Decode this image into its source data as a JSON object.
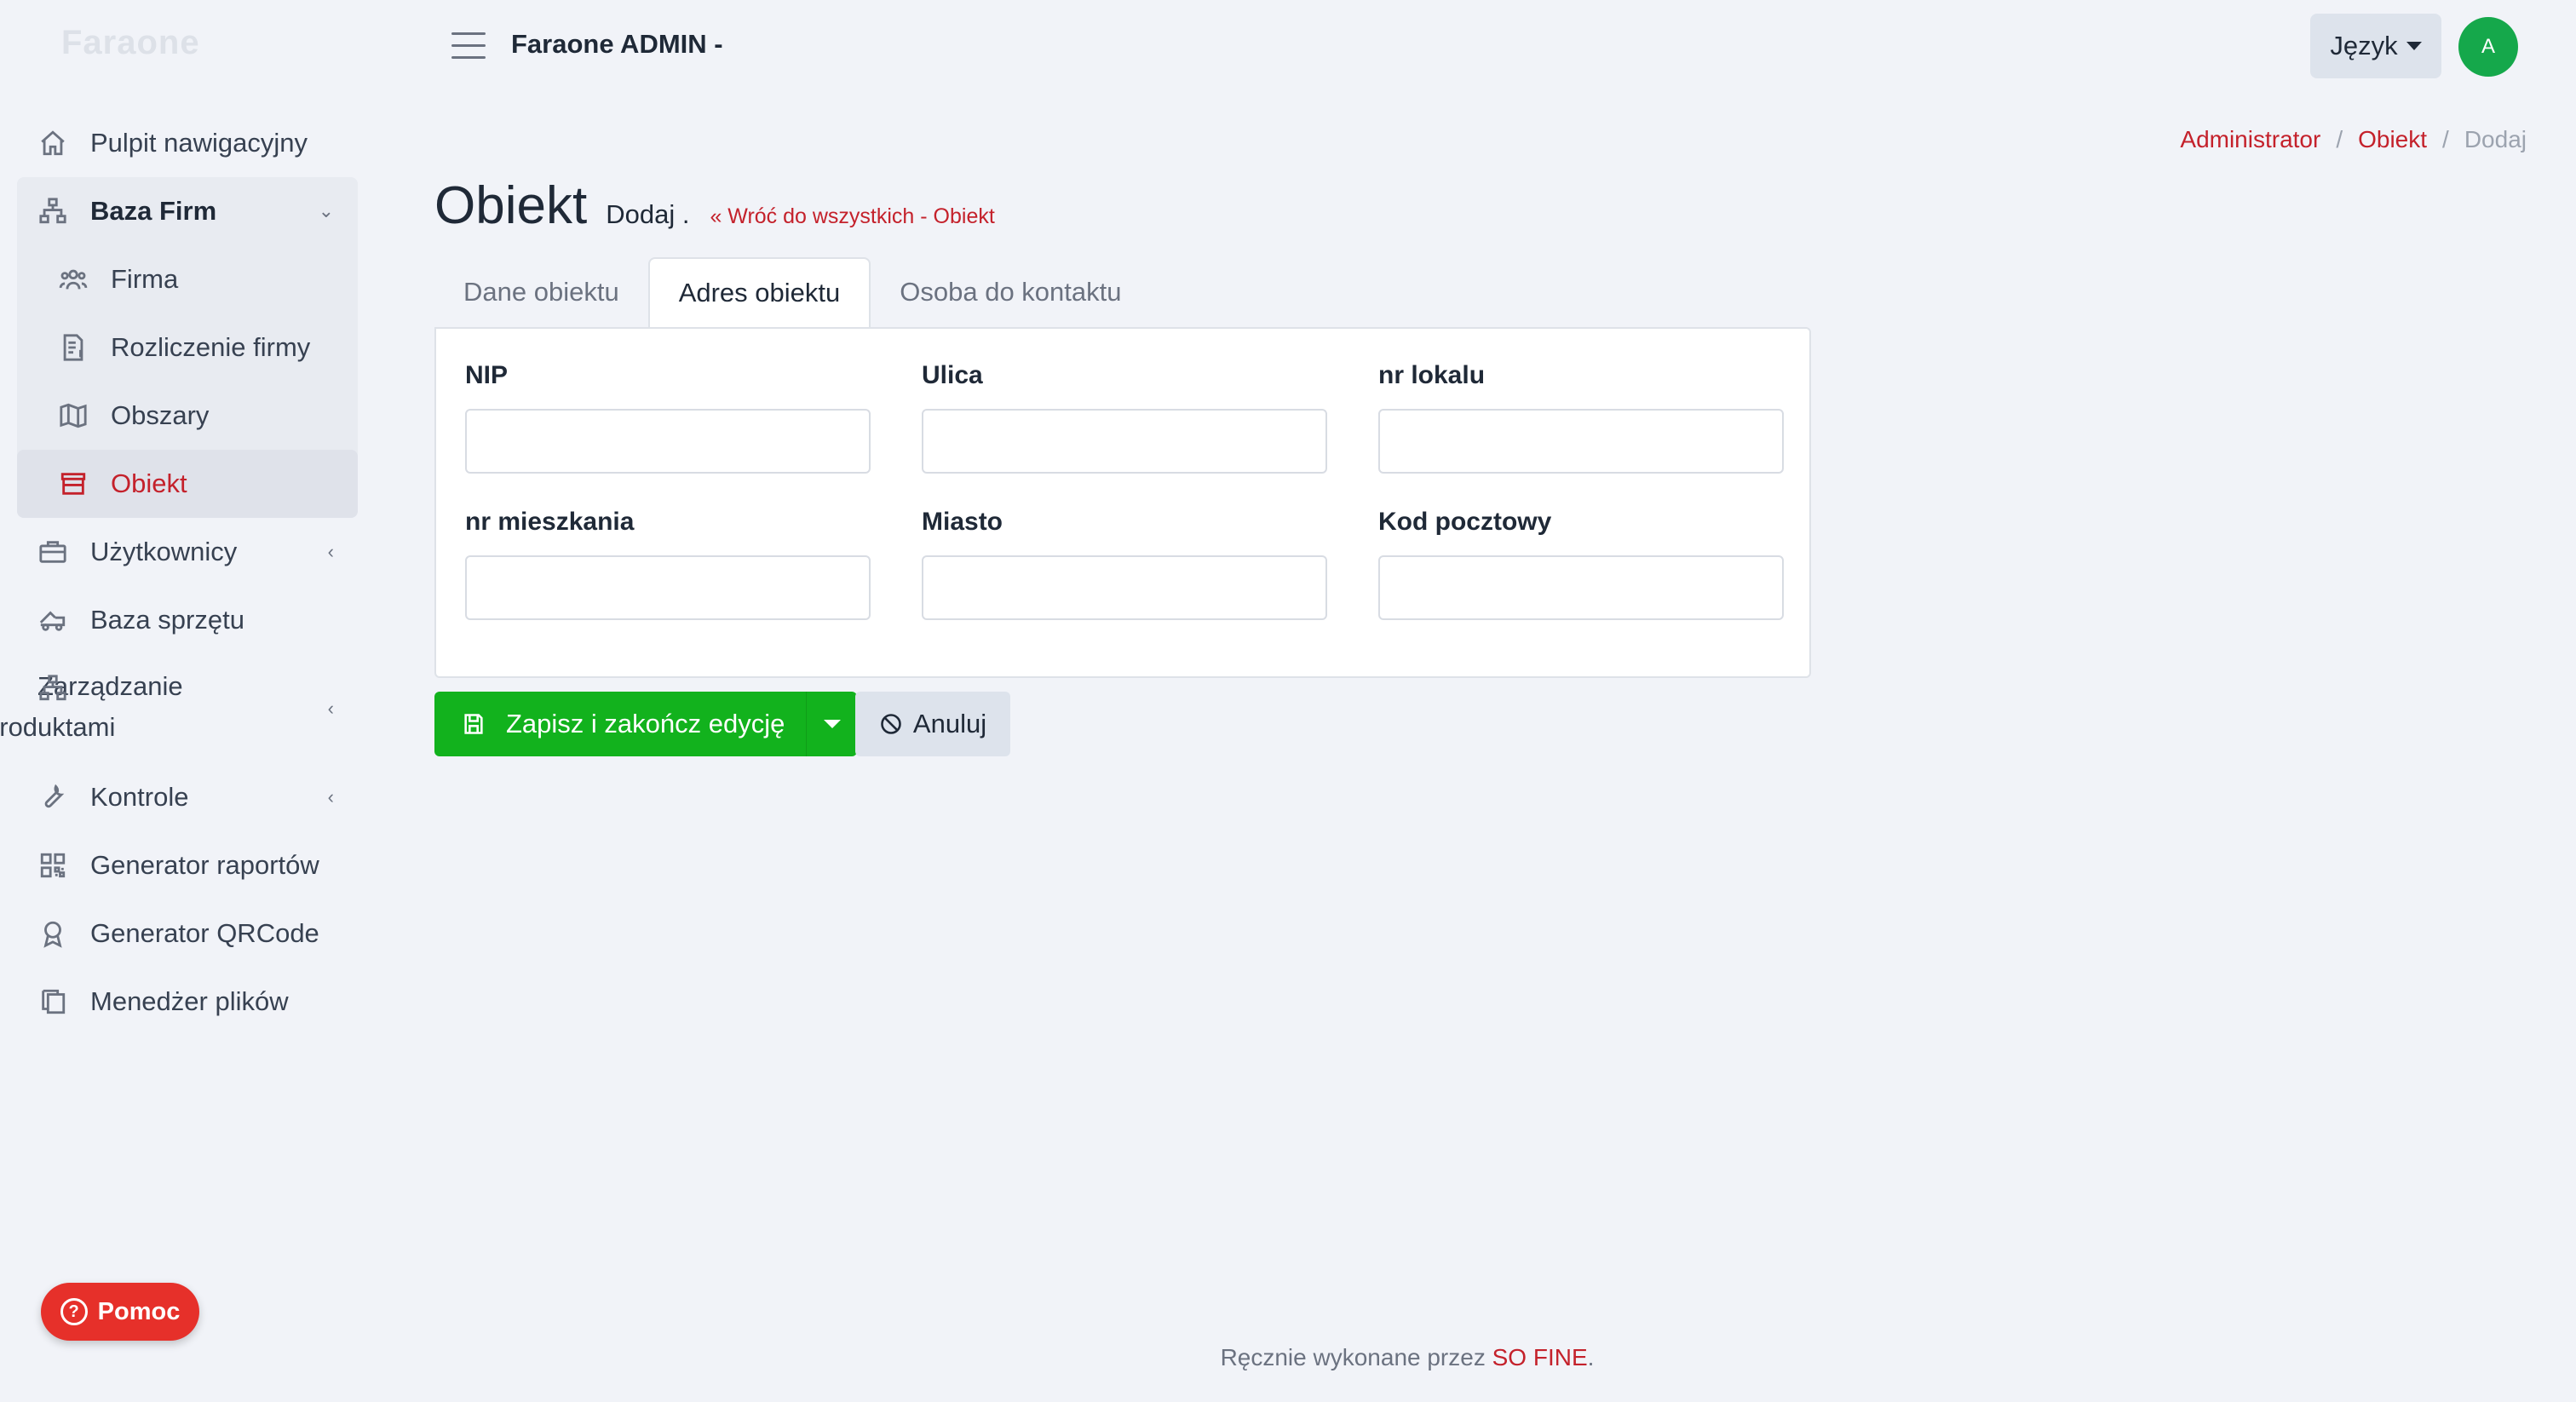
{
  "app": {
    "brand": "Faraone",
    "top_title": "Faraone ADMIN -",
    "language_label": "Język",
    "avatar_initial": "A",
    "help_label": "Pomoc"
  },
  "sidebar": {
    "items": [
      {
        "label": "Pulpit nawigacyjny",
        "icon": "home-icon"
      },
      {
        "label": "Baza Firm",
        "icon": "sitemap-icon",
        "expanded": true,
        "children": [
          {
            "label": "Firma",
            "icon": "users-icon"
          },
          {
            "label": "Rozliczenie firmy",
            "icon": "invoice-icon"
          },
          {
            "label": "Obszary",
            "icon": "map-icon"
          },
          {
            "label": "Obiekt",
            "icon": "store-icon",
            "active": true
          }
        ]
      },
      {
        "label": "Użytkownicy",
        "icon": "briefcase-icon"
      },
      {
        "label": "Baza sprzętu",
        "icon": "truck-icon"
      },
      {
        "label": "Zarządzanie produktami",
        "icon": "sitemap-icon"
      },
      {
        "label": "Kontrole",
        "icon": "wrench-icon"
      },
      {
        "label": "Generator raportów",
        "icon": "qrcode-icon"
      },
      {
        "label": "Generator QRCode",
        "icon": "award-icon"
      },
      {
        "label": "Menedżer plików",
        "icon": "copy-icon"
      }
    ]
  },
  "breadcrumb": {
    "items": [
      "Administrator",
      "Obiekt"
    ],
    "current": "Dodaj",
    "separator": "/"
  },
  "page": {
    "title": "Obiekt",
    "subtitle": "Dodaj .",
    "back_link": "Wróć do wszystkich - Obiekt"
  },
  "tabs": [
    {
      "label": "Dane obiektu",
      "active": false
    },
    {
      "label": "Adres obiektu",
      "active": true
    },
    {
      "label": "Osoba do kontaktu",
      "active": false
    }
  ],
  "form": {
    "fields": [
      {
        "label": "NIP",
        "value": ""
      },
      {
        "label": "Ulica",
        "value": ""
      },
      {
        "label": "nr lokalu",
        "value": ""
      },
      {
        "label": "nr mieszkania",
        "value": ""
      },
      {
        "label": "Miasto",
        "value": ""
      },
      {
        "label": "Kod pocztowy",
        "value": ""
      }
    ]
  },
  "actions": {
    "save_label": "Zapisz i zakończ edycję",
    "cancel_label": "Anuluj"
  },
  "footer": {
    "text": "Ręcznie wykonane przez",
    "brand": "SO FINE",
    "suffix": "."
  },
  "colors": {
    "accent": "#c4212b",
    "success": "#12b21d",
    "help": "#e6302a",
    "avatar": "#15a84b"
  }
}
